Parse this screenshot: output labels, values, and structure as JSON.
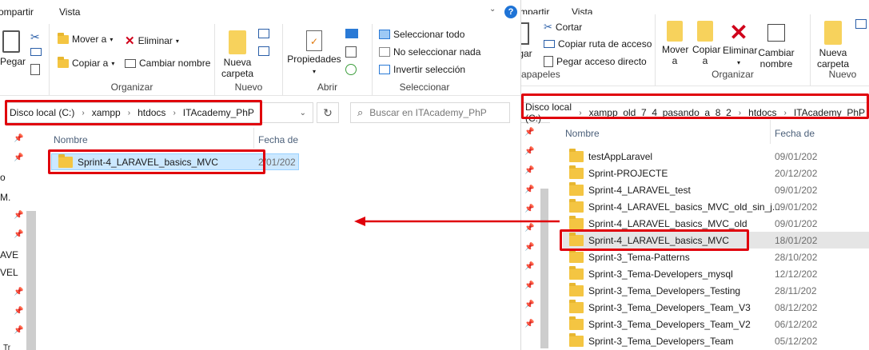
{
  "left": {
    "tabs": [
      "ompartir",
      "Vista"
    ],
    "ribbon": {
      "paste_label": "Pegar",
      "move_label": "Mover a",
      "copy_label": "Copiar a",
      "delete_label": "Eliminar",
      "rename_label": "Cambiar nombre",
      "organize_group": "Organizar",
      "new_folder_label": "Nueva carpeta",
      "new_group": "Nuevo",
      "properties_label": "Propiedades",
      "open_group": "Abrir",
      "select_all": "Seleccionar todo",
      "select_none": "No seleccionar nada",
      "invert_selection": "Invertir selección",
      "select_group": "Seleccionar"
    },
    "breadcrumb": [
      "Disco local (C:)",
      "xampp",
      "htdocs",
      "ITAcademy_PhP"
    ],
    "search_placeholder": "Buscar en ITAcademy_PhP",
    "columns": {
      "name": "Nombre",
      "date": "Fecha de"
    },
    "nav_fragments": [
      "o",
      "M.",
      "AVE",
      "VEL",
      "Tr"
    ],
    "rows": [
      {
        "name": "Sprint-4_LARAVEL_basics_MVC",
        "date": "2/01/202"
      }
    ]
  },
  "right": {
    "tabs": [
      "mpartir",
      "Vista"
    ],
    "ribbon": {
      "paste_label": "gar",
      "cut_label": "Cortar",
      "copy_path_label": "Copiar ruta de acceso",
      "paste_shortcut_label": "Pegar acceso directo",
      "clipboard_group": "apapeles",
      "move_label": "Mover a",
      "copy_label": "Copiar a",
      "delete_label": "Eliminar",
      "rename_label": "Cambiar nombre",
      "organize_group": "Organizar",
      "new_folder_label": "Nueva carpeta",
      "new_group": "Nuevo"
    },
    "breadcrumb": [
      "Disco local (C:)",
      "xampp_old_7_4_pasando_a_8_2",
      "htdocs",
      "ITAcademy_PhP"
    ],
    "columns": {
      "name": "Nombre",
      "date": "Fecha de"
    },
    "rows": [
      {
        "name": "testAppLaravel",
        "date": "09/01/202"
      },
      {
        "name": "Sprint-PROJECTE",
        "date": "20/12/202"
      },
      {
        "name": "Sprint-4_LARAVEL_test",
        "date": "09/01/202"
      },
      {
        "name": "Sprint-4_LARAVEL_basics_MVC_old_sin_j...",
        "date": "09/01/202"
      },
      {
        "name": "Sprint-4_LARAVEL_basics_MVC_old",
        "date": "09/01/202"
      },
      {
        "name": "Sprint-4_LARAVEL_basics_MVC",
        "date": "18/01/202"
      },
      {
        "name": "Sprint-3_Tema-Patterns",
        "date": "28/10/202"
      },
      {
        "name": "Sprint-3_Tema-Developers_mysql",
        "date": "12/12/202"
      },
      {
        "name": "Sprint-3_Tema_Developers_Testing",
        "date": "28/11/202"
      },
      {
        "name": "Sprint-3_Tema_Developers_Team_V3",
        "date": "08/12/202"
      },
      {
        "name": "Sprint-3_Tema_Developers_Team_V2",
        "date": "06/12/202"
      },
      {
        "name": "Sprint-3_Tema_Developers_Team",
        "date": "05/12/202"
      }
    ]
  },
  "colors": {
    "highlight": "#e0000b",
    "selection": "#cce8ff",
    "hover": "#e5e5e5",
    "accent": "#1e73d6"
  }
}
